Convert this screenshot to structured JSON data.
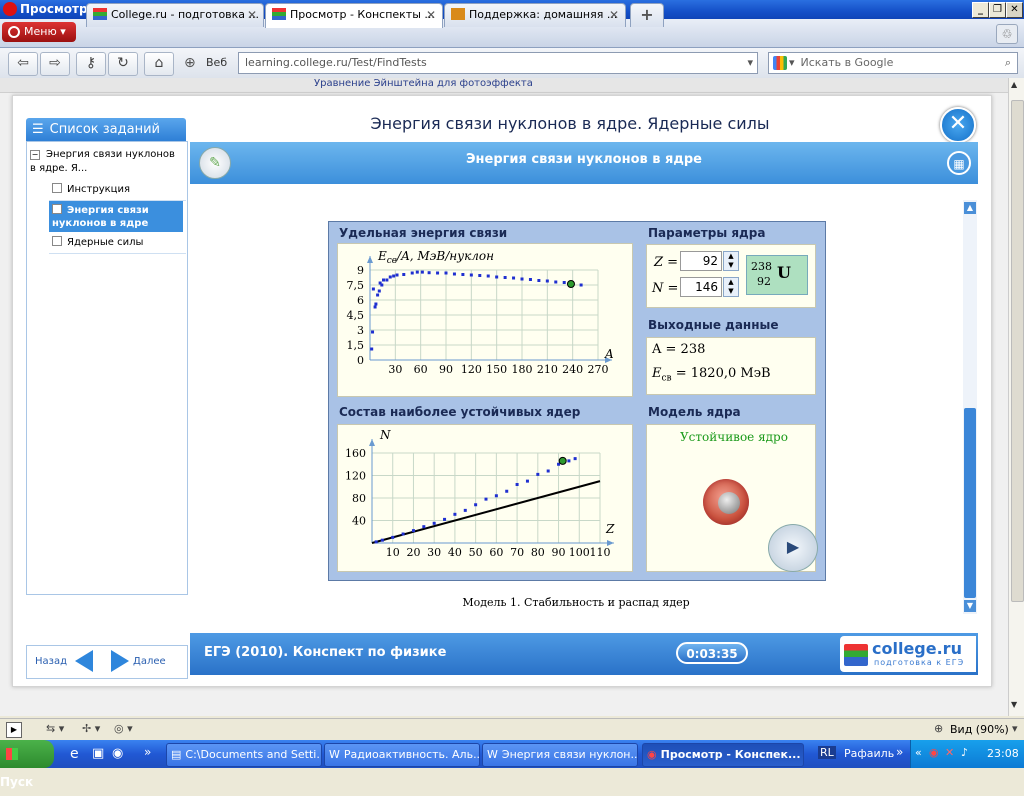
{
  "window": {
    "title": "Просмотр - Конспекты по физике - college.ru - Opera"
  },
  "browser": {
    "menu_label": "Меню",
    "tabs": [
      {
        "label": "College.ru - подготовка ..."
      },
      {
        "label": "Просмотр - Конспекты ..."
      },
      {
        "label": "Поддержка: домашняя ..."
      }
    ],
    "search_engine_label": "Веб",
    "url": "learning.college.ru/Test/FindTests",
    "search_placeholder": "Искать в Google",
    "status_zoom": "Вид (90%)"
  },
  "page": {
    "top_strip_text": "Уравнение Эйнштейна для фотоэффекта",
    "main_title": "Энергия связи нуклонов в ядре. Ядерные силы",
    "subtitle": "Энергия связи нуклонов в ядре",
    "left_panel": {
      "header": "Список заданий",
      "root_item": "Энергия связи нуклонов в ядре. Я...",
      "items": [
        {
          "label": "Инструкция",
          "selected": false
        },
        {
          "label": "Энергия связи нуклонов в ядре",
          "selected": true
        },
        {
          "label": "Ядерные силы",
          "selected": false
        }
      ],
      "nav_back": "Назад",
      "nav_forward": "Далее"
    },
    "bottom_bar": {
      "course": "ЕГЭ (2010). Конспект по физике",
      "timer": "0:03:35",
      "logo": "college.ru",
      "logo_sub": "подготовка к ЕГЭ"
    },
    "caption": "Модель 1. Стабильность и распад ядер"
  },
  "model": {
    "binding_title": "Удельная энергия связи",
    "binding_ylabel_main": "E",
    "binding_ylabel_sub": "св",
    "binding_ylabel_rest": "/A, МэВ/нуклон",
    "binding_xlabel": "A",
    "stability_title": "Состав наиболее устойчивых ядер",
    "stability_ylabel": "N",
    "stability_xlabel": "Z",
    "params_title": "Параметры ядра",
    "z_label": "Z =",
    "z_value": "92",
    "n_label": "N =",
    "n_value": "146",
    "element_mass": "238",
    "element_number": "92",
    "element_symbol": "U",
    "output_title": "Выходные данные",
    "a_output": "A = 238",
    "e_output_label": "E",
    "e_output_sub": "св",
    "e_output_value": " = 1820,0 МэВ",
    "nucleus_title": "Модель ядра",
    "nucleus_status": "Устойчивое ядро"
  },
  "chart_data": [
    {
      "type": "scatter",
      "title": "Удельная энергия связи",
      "xlabel": "A",
      "ylabel": "Eсв/A, МэВ/нуклон",
      "xlim": [
        0,
        270
      ],
      "ylim": [
        0,
        9
      ],
      "xticks": [
        30,
        60,
        90,
        120,
        150,
        180,
        210,
        240,
        270
      ],
      "yticks": [
        0,
        1.5,
        3,
        4.5,
        6,
        7.5,
        9
      ],
      "series": [
        {
          "x": [
            2,
            3,
            4,
            6,
            7,
            9,
            11,
            12,
            14,
            16,
            20,
            24,
            28,
            32,
            40,
            50,
            56,
            62,
            70,
            80,
            90,
            100,
            110,
            120,
            130,
            140,
            150,
            160,
            170,
            180,
            190,
            200,
            210,
            220,
            230,
            240,
            250
          ],
          "y": [
            1.1,
            2.8,
            7.1,
            5.3,
            5.6,
            6.5,
            6.9,
            7.7,
            7.5,
            8.0,
            8.0,
            8.3,
            8.4,
            8.5,
            8.55,
            8.7,
            8.79,
            8.79,
            8.73,
            8.7,
            8.7,
            8.6,
            8.55,
            8.5,
            8.45,
            8.4,
            8.3,
            8.25,
            8.2,
            8.1,
            8.05,
            7.95,
            7.9,
            7.8,
            7.75,
            7.6,
            7.5
          ]
        }
      ],
      "highlight": {
        "x": 238,
        "y": 7.6
      }
    },
    {
      "type": "scatter",
      "title": "Состав наиболее устойчивых ядер",
      "xlabel": "Z",
      "ylabel": "N",
      "xlim": [
        0,
        110
      ],
      "ylim": [
        0,
        160
      ],
      "xticks": [
        10,
        20,
        30,
        40,
        50,
        60,
        70,
        80,
        90,
        100,
        110
      ],
      "yticks": [
        40,
        80,
        120,
        160
      ],
      "series": [
        {
          "x": [
            2,
            5,
            10,
            15,
            20,
            25,
            30,
            35,
            40,
            45,
            50,
            55,
            60,
            65,
            70,
            75,
            80,
            85,
            90,
            95,
            98
          ],
          "y": [
            2,
            5,
            10,
            16,
            22,
            29,
            35,
            42,
            51,
            58,
            68,
            78,
            84,
            92,
            104,
            110,
            122,
            128,
            140,
            146,
            150
          ]
        }
      ],
      "reference_line": {
        "x": [
          0,
          110
        ],
        "y": [
          0,
          110
        ]
      },
      "highlight": {
        "x": 92,
        "y": 146
      }
    }
  ],
  "taskbar": {
    "start": "Пуск",
    "tasks": [
      {
        "label": "C:\\Documents and Setti..."
      },
      {
        "label": "Радиоактивность. Аль..."
      },
      {
        "label": "Энергия связи нуклон..."
      },
      {
        "label": "Просмотр - Конспек..."
      }
    ],
    "language": "RL",
    "user": "Рафаиль",
    "clock": "23:08"
  },
  "colors": {
    "accent": "#3c8fdb",
    "plot_series": "#1f2fd0",
    "highlight": "#2e9a2e"
  }
}
